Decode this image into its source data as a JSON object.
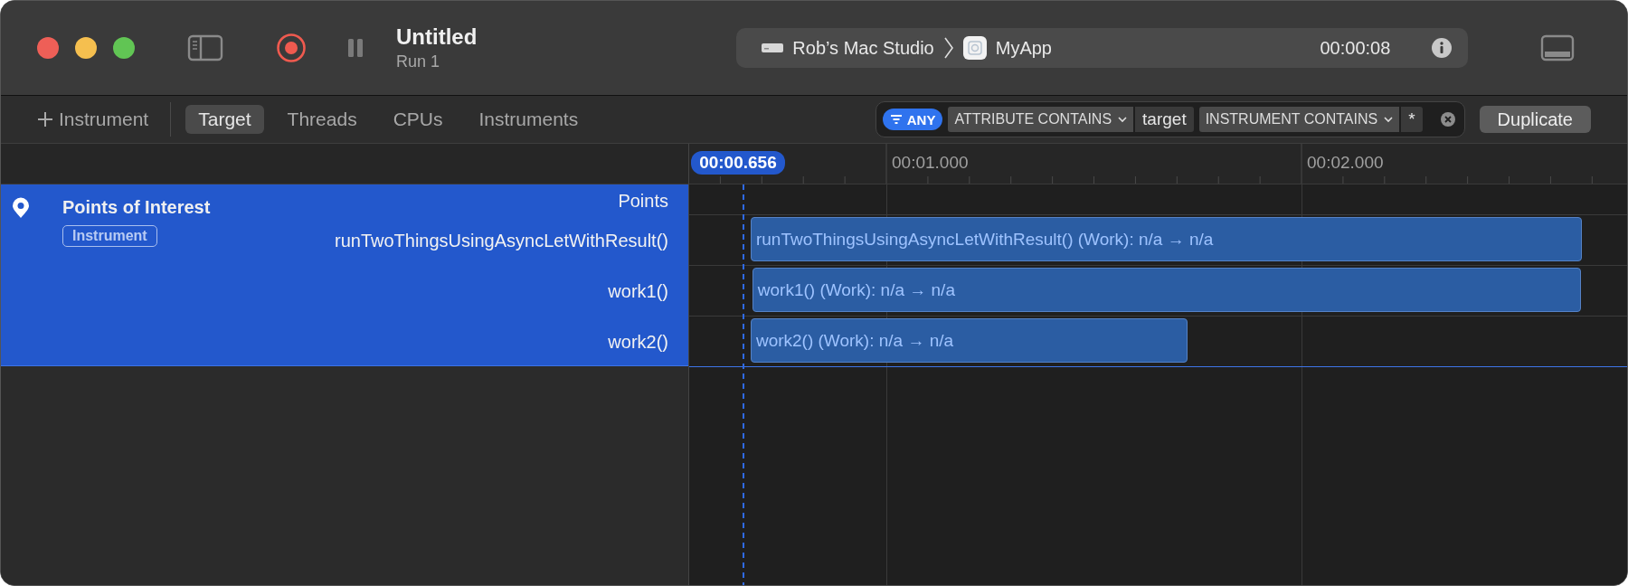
{
  "window": {
    "title": "Untitled",
    "subtitle": "Run 1"
  },
  "scheme": {
    "device": "Rob’s Mac Studio",
    "app": "MyApp",
    "elapsed": "00:00:08"
  },
  "add_instrument": "Instrument",
  "tabs": [
    {
      "label": "Target",
      "selected": true
    },
    {
      "label": "Threads",
      "selected": false
    },
    {
      "label": "CPUs",
      "selected": false
    },
    {
      "label": "Instruments",
      "selected": false
    }
  ],
  "filter": {
    "mode": "ANY",
    "tokens": [
      {
        "label": "ATTRIBUTE CONTAINS",
        "value": "target"
      },
      {
        "label": "INSTRUMENT CONTAINS",
        "value": "*"
      }
    ]
  },
  "duplicate_button": "Duplicate",
  "ruler": {
    "playhead": "00:00.656",
    "ticks": [
      "00:01.000",
      "00:02.000"
    ]
  },
  "track": {
    "name": "Points of Interest",
    "badge": "Instrument",
    "selected": true,
    "lanes": [
      {
        "label": "Points"
      },
      {
        "label": "runTwoThingsUsingAsyncLetWithResult()",
        "interval": "runTwoThingsUsingAsyncLetWithResult() (Work): n/a → n/a"
      },
      {
        "label": "work1()",
        "interval": "work1() (Work): n/a → n/a"
      },
      {
        "label": "work2()",
        "interval": "work2() (Work): n/a → n/a"
      }
    ]
  }
}
